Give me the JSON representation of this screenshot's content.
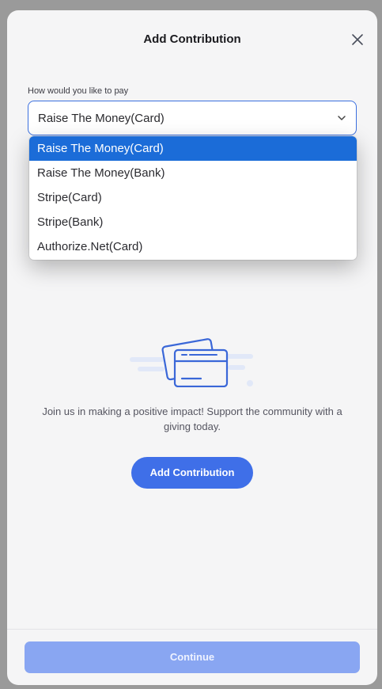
{
  "modal": {
    "title": "Add Contribution",
    "close_icon": "close-icon"
  },
  "payment": {
    "label": "How would you like to pay",
    "selected": "Raise The Money(Card)",
    "options": [
      "Raise The Money(Card)",
      "Raise The Money(Bank)",
      "Stripe(Card)",
      "Stripe(Bank)",
      "Authorize.Net(Card)"
    ]
  },
  "empty_state": {
    "icon": "credit-cards-icon",
    "description": "Join us in making a positive impact! Support the community with a giving today.",
    "button_label": "Add Contribution"
  },
  "footer": {
    "continue_label": "Continue"
  },
  "colors": {
    "accent": "#3f6fe8",
    "selected_option": "#1b6cd8",
    "continue_disabled": "#89a6f2"
  }
}
